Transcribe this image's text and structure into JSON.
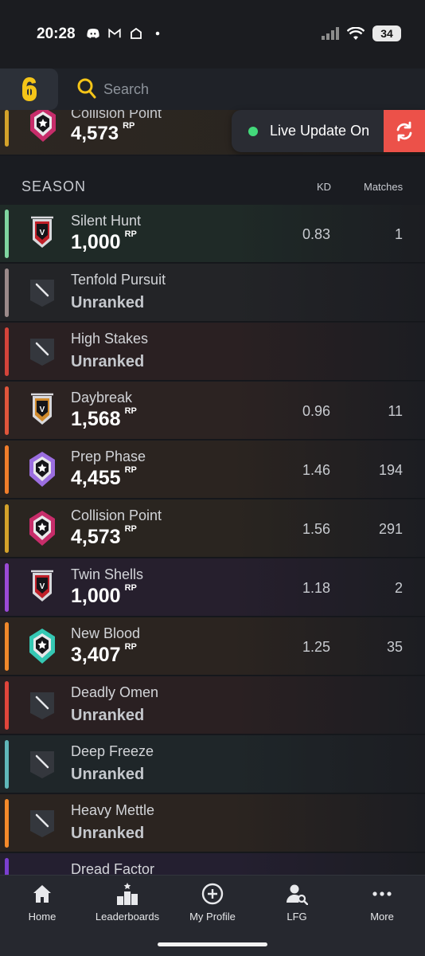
{
  "status_bar": {
    "time": "20:28",
    "left_icons": [
      "discord-icon",
      "gmail-icon",
      "home-icon",
      "dot-icon"
    ],
    "battery": "34"
  },
  "header": {
    "search_placeholder": "Search",
    "logo": "rainbow-six-logo",
    "accent_color": "#f5c518"
  },
  "top_row": {
    "name": "Collision Point",
    "rp": "4,573",
    "rp_unit": "RP",
    "rank_icon": "champion-badge-icon"
  },
  "live_update": {
    "label": "Live Update On",
    "status_color": "#43d97a",
    "button_color": "#ec5149"
  },
  "season": {
    "title": "SEASON",
    "col_kd": "KD",
    "col_matches": "Matches",
    "rows": [
      {
        "name": "Silent Hunt",
        "rp": "1,000",
        "unit": "RP",
        "kd": "0.83",
        "matches": "1",
        "accent": "#7fd6a0",
        "icon": "copper-v-badge-icon",
        "bg": "#1f2a27"
      },
      {
        "name": "Tenfold Pursuit",
        "status": "Unranked",
        "accent": "#9b8a8a",
        "icon": "unranked-badge-icon",
        "bg": "#232427"
      },
      {
        "name": "High Stakes",
        "status": "Unranked",
        "accent": "#d4443a",
        "icon": "unranked-badge-icon",
        "bg": "#2a2022"
      },
      {
        "name": "Daybreak",
        "rp": "1,568",
        "unit": "RP",
        "kd": "0.96",
        "matches": "11",
        "accent": "#e0553b",
        "icon": "bronze-v-badge-icon",
        "bg": "#2c2322"
      },
      {
        "name": "Prep Phase",
        "rp": "4,455",
        "unit": "RP",
        "kd": "1.46",
        "matches": "194",
        "accent": "#f07d2a",
        "icon": "diamond-badge-icon",
        "bg": "#2b2420"
      },
      {
        "name": "Collision Point",
        "rp": "4,573",
        "unit": "RP",
        "kd": "1.56",
        "matches": "291",
        "accent": "#d4a22a",
        "icon": "champion-badge-icon",
        "bg": "#2a2520"
      },
      {
        "name": "Twin Shells",
        "rp": "1,000",
        "unit": "RP",
        "kd": "1.18",
        "matches": "2",
        "accent": "#9a4ad6",
        "icon": "copper-v-badge-icon",
        "bg": "#261f2d"
      },
      {
        "name": "New Blood",
        "rp": "3,407",
        "unit": "RP",
        "kd": "1.25",
        "matches": "35",
        "accent": "#f0882a",
        "icon": "emerald-badge-icon",
        "bg": "#2b2420"
      },
      {
        "name": "Deadly Omen",
        "status": "Unranked",
        "accent": "#e0453b",
        "icon": "unranked-badge-icon",
        "bg": "#2a2022"
      },
      {
        "name": "Deep Freeze",
        "status": "Unranked",
        "accent": "#5fb7b9",
        "icon": "unranked-badge-icon",
        "bg": "#1f2629"
      },
      {
        "name": "Heavy Mettle",
        "status": "Unranked",
        "accent": "#f58a2a",
        "icon": "unranked-badge-icon",
        "bg": "#2b2420"
      },
      {
        "name": "Dread Factor",
        "status": "",
        "accent": "#7b3fd0",
        "icon": "",
        "bg": "#241f30"
      }
    ]
  },
  "nav": [
    {
      "label": "Home",
      "icon": "home-icon"
    },
    {
      "label": "Leaderboards",
      "icon": "podium-icon"
    },
    {
      "label": "My Profile",
      "icon": "plus-circle-icon"
    },
    {
      "label": "LFG",
      "icon": "user-search-icon"
    },
    {
      "label": "More",
      "icon": "more-dots-icon"
    }
  ]
}
